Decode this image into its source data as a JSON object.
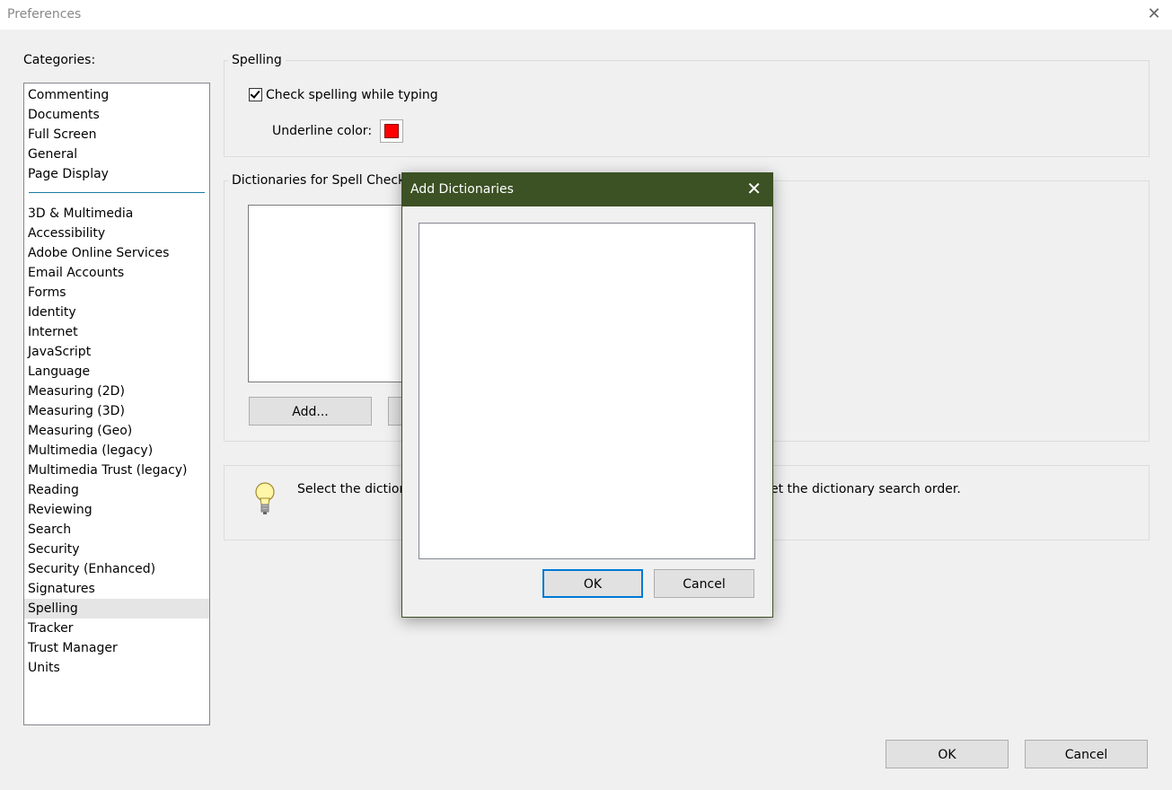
{
  "window": {
    "title": "Preferences",
    "close_glyph": "✕"
  },
  "categories": {
    "label": "Categories:",
    "top_items": [
      "Commenting",
      "Documents",
      "Full Screen",
      "General",
      "Page Display"
    ],
    "items": [
      "3D & Multimedia",
      "Accessibility",
      "Adobe Online Services",
      "Email Accounts",
      "Forms",
      "Identity",
      "Internet",
      "JavaScript",
      "Language",
      "Measuring (2D)",
      "Measuring (3D)",
      "Measuring (Geo)",
      "Multimedia (legacy)",
      "Multimedia Trust (legacy)",
      "Reading",
      "Reviewing",
      "Search",
      "Security",
      "Security (Enhanced)",
      "Signatures",
      "Spelling",
      "Tracker",
      "Trust Manager",
      "Units"
    ],
    "selected": "Spelling"
  },
  "spelling": {
    "group_title": "Spelling",
    "check_label": "Check spelling while typing",
    "checked": true,
    "underline_label": "Underline color:",
    "underline_color": "#ff0000"
  },
  "dictionaries": {
    "group_title": "Dictionaries for Spell Check",
    "add_button": "Add..."
  },
  "tip": {
    "text_left": "Select the diction",
    "text_right": "et the dictionary search order.",
    "icon": "lightbulb-icon"
  },
  "footer": {
    "ok": "OK",
    "cancel": "Cancel"
  },
  "add_dialog": {
    "title": "Add Dictionaries",
    "close_glyph": "✕",
    "ok": "OK",
    "cancel": "Cancel",
    "title_color": "#3c5124"
  }
}
